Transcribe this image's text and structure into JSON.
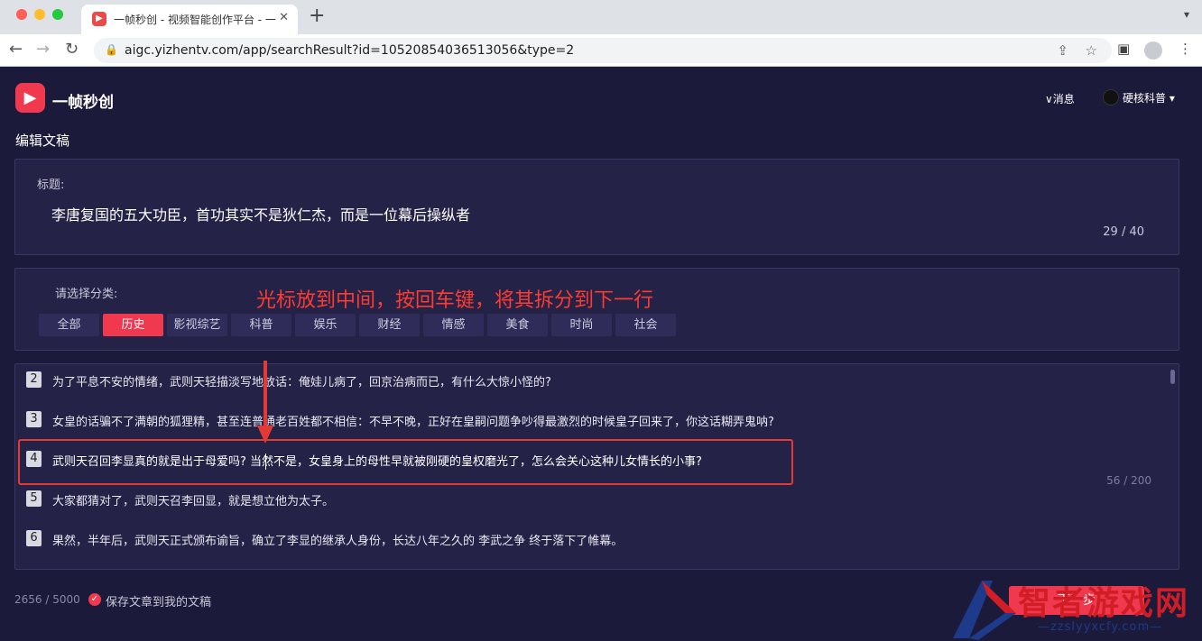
{
  "browser": {
    "tab_title": "一帧秒创 - 视频智能创作平台 - 一",
    "url": "aigc.yizhentv.com/app/searchResult?id=10520854036513056&type=2"
  },
  "header": {
    "brand": "一帧秒创",
    "messages": "∨消息",
    "user_name": "硬核科普 ▾"
  },
  "page": {
    "section_title": "编辑文稿"
  },
  "title_panel": {
    "label": "标题:",
    "value": "李唐复国的五大功臣，首功其实不是狄仁杰，而是一位幕后操纵者",
    "counter": "29 / 40"
  },
  "category_panel": {
    "label": "请选择分类:",
    "categories": [
      {
        "label": "全部",
        "active": false
      },
      {
        "label": "历史",
        "active": true
      },
      {
        "label": "影视综艺",
        "active": false
      },
      {
        "label": "科普",
        "active": false
      },
      {
        "label": "娱乐",
        "active": false
      },
      {
        "label": "财经",
        "active": false
      },
      {
        "label": "情感",
        "active": false
      },
      {
        "label": "美食",
        "active": false
      },
      {
        "label": "时尚",
        "active": false
      },
      {
        "label": "社会",
        "active": false
      }
    ]
  },
  "annotation": {
    "text": "光标放到中间，按回车键，将其拆分到下一行"
  },
  "paragraphs": {
    "counter": "56 / 200",
    "items": [
      {
        "num": "2",
        "text": "为了平息不安的情绪，武则天轻描淡写地放话：俺娃儿病了，回京治病而已，有什么大惊小怪的?"
      },
      {
        "num": "3",
        "text": "女皇的话骗不了满朝的狐狸精，甚至连普通老百姓都不相信：不早不晚，正好在皇嗣问题争吵得最激烈的时候皇子回来了，你这话糊弄鬼呐?"
      },
      {
        "num": "4",
        "text": "武则天召回李显真的就是出于母爱吗? 当然不是，女皇身上的母性早就被刚硬的皇权磨光了，怎么会关心这种儿女情长的小事?"
      },
      {
        "num": "5",
        "text": "大家都猜对了，武则天召李回显，就是想立他为太子。"
      },
      {
        "num": "6",
        "text": "果然，半年后，武则天正式颁布谕旨，确立了李显的继承人身份，长达八年之久的 李武之争 终于落下了帷幕。"
      }
    ]
  },
  "footer": {
    "word_count": "2656 / 5000",
    "save_label": "保存文章到我的文稿",
    "next_label": "下一步"
  },
  "watermark": {
    "title": "智者游戏网",
    "url": "—zzslyyxcfy.com—"
  }
}
